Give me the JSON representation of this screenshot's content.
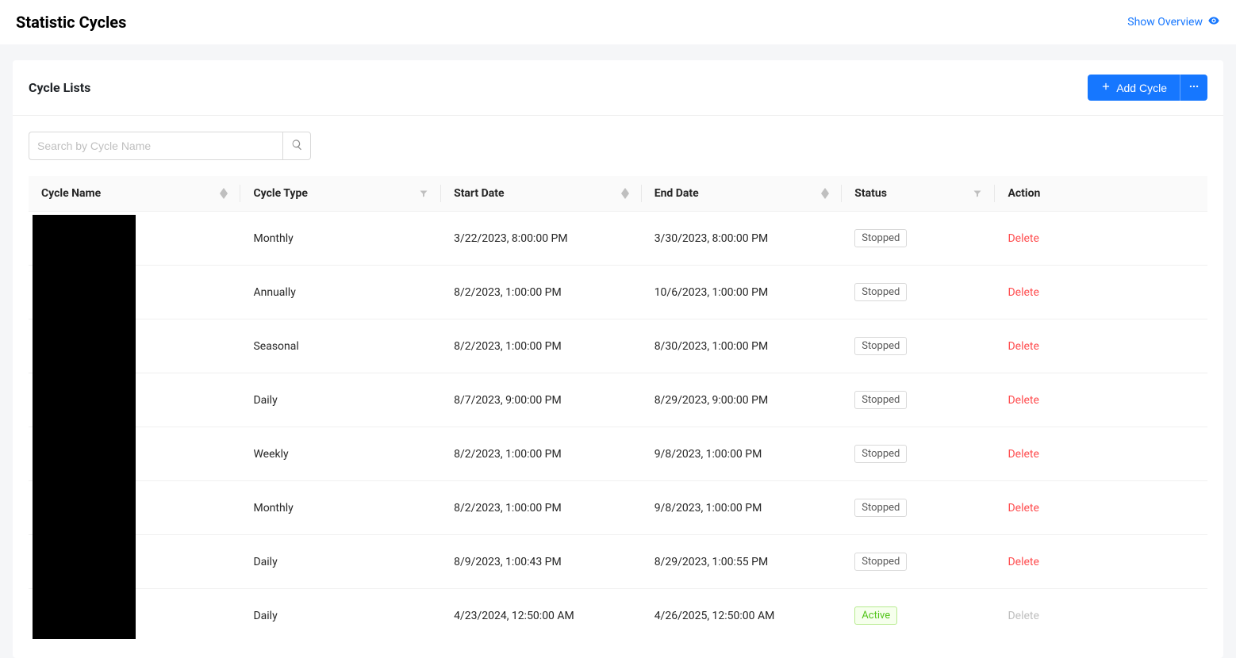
{
  "header": {
    "title": "Statistic Cycles",
    "overview_link": "Show Overview"
  },
  "card": {
    "title": "Cycle Lists",
    "add_button_label": "Add Cycle",
    "search_placeholder": "Search by Cycle Name"
  },
  "table": {
    "columns": {
      "cycle_name": "Cycle Name",
      "cycle_type": "Cycle Type",
      "start_date": "Start Date",
      "end_date": "End Date",
      "status": "Status",
      "action": "Action"
    },
    "rows": [
      {
        "cycle_type": "Monthly",
        "start_date": "3/22/2023, 8:00:00 PM",
        "end_date": "3/30/2023, 8:00:00 PM",
        "status": "Stopped",
        "action": "Delete",
        "deletable": true
      },
      {
        "cycle_type": "Annually",
        "start_date": "8/2/2023, 1:00:00 PM",
        "end_date": "10/6/2023, 1:00:00 PM",
        "status": "Stopped",
        "action": "Delete",
        "deletable": true
      },
      {
        "cycle_type": "Seasonal",
        "start_date": "8/2/2023, 1:00:00 PM",
        "end_date": "8/30/2023, 1:00:00 PM",
        "status": "Stopped",
        "action": "Delete",
        "deletable": true
      },
      {
        "cycle_type": "Daily",
        "start_date": "8/7/2023, 9:00:00 PM",
        "end_date": "8/29/2023, 9:00:00 PM",
        "status": "Stopped",
        "action": "Delete",
        "deletable": true
      },
      {
        "cycle_type": "Weekly",
        "start_date": "8/2/2023, 1:00:00 PM",
        "end_date": "9/8/2023, 1:00:00 PM",
        "status": "Stopped",
        "action": "Delete",
        "deletable": true
      },
      {
        "cycle_type": "Monthly",
        "start_date": "8/2/2023, 1:00:00 PM",
        "end_date": "9/8/2023, 1:00:00 PM",
        "status": "Stopped",
        "action": "Delete",
        "deletable": true
      },
      {
        "cycle_type": "Daily",
        "start_date": "8/9/2023, 1:00:43 PM",
        "end_date": "8/29/2023, 1:00:55 PM",
        "status": "Stopped",
        "action": "Delete",
        "deletable": true
      },
      {
        "cycle_type": "Daily",
        "start_date": "4/23/2024, 12:50:00 AM",
        "end_date": "4/26/2025, 12:50:00 AM",
        "status": "Active",
        "action": "Delete",
        "deletable": false
      }
    ]
  }
}
